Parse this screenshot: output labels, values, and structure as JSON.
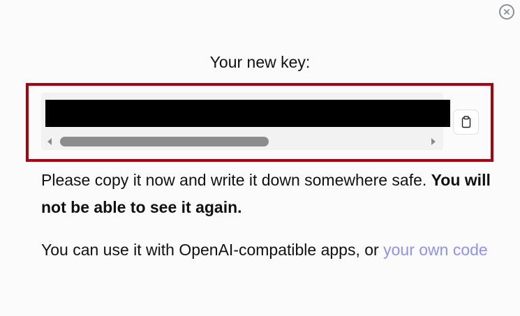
{
  "dialog": {
    "close_icon": "close-circle-icon",
    "title": "Your new key:",
    "key": {
      "value": "",
      "copy_icon": "clipboard-icon",
      "scroll_position": 0,
      "scroll_visible_fraction": 0.57
    },
    "warning": {
      "text": "Please copy it now and write it down somewhere safe.",
      "emphasis": "You will not be able to see it again."
    },
    "usage": {
      "text": "You can use it with OpenAI-compatible apps, or",
      "link_label": "your own code"
    },
    "colors": {
      "highlight_frame": "#b0000b",
      "link": "#8f92ef"
    }
  }
}
